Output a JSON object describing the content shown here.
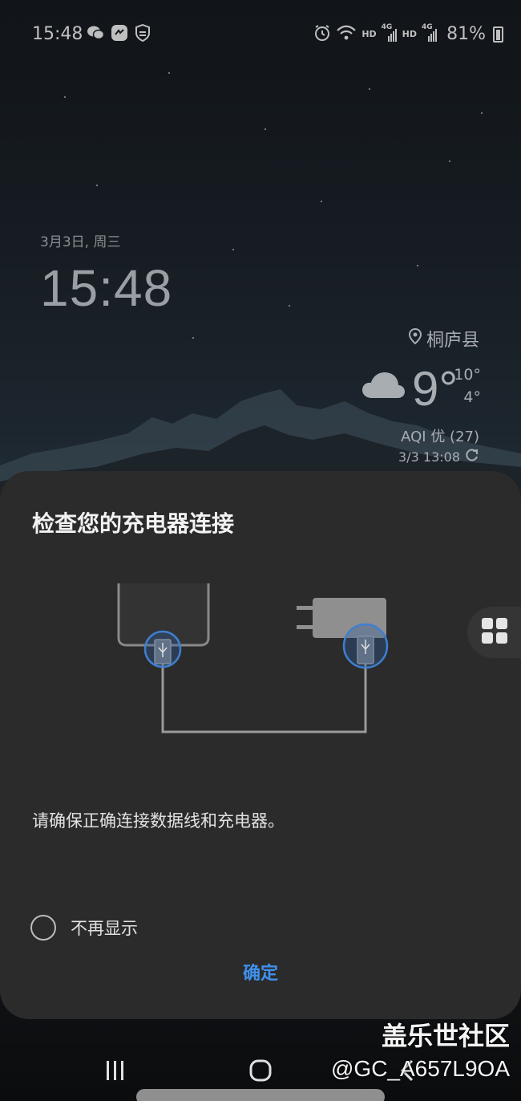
{
  "status_bar": {
    "time": "15:48",
    "left_icons": [
      "wechat-icon",
      "messenger-icon",
      "shield-icon"
    ],
    "right_icons": [
      "alarm-icon",
      "wifi-icon",
      "signal-icon-sim1",
      "signal-icon-sim2"
    ],
    "hd_label_1": "HD",
    "hd_label_2": "HD",
    "net_label_1": "4G",
    "net_label_2": "4G",
    "battery": "81%"
  },
  "lockscreen": {
    "date": "3月3日, 周三",
    "clock": "15:48"
  },
  "weather": {
    "location": "桐庐县",
    "temperature": "9°",
    "high": "10°",
    "low": "4°",
    "aqi": "AQI 优 (27)",
    "updated": "3/3 13:08",
    "icon": "cloud-icon"
  },
  "dialog": {
    "title": "检查您的充电器连接",
    "message": "请确保正确连接数据线和充电器。",
    "checkbox_label": "不再显示",
    "checkbox_checked": false,
    "confirm_label": "确定",
    "accent_color": "#3f91ec"
  },
  "navigation": {
    "recents_icon": "recents-icon",
    "home_icon": "home-icon",
    "back_icon": "back-icon"
  },
  "watermark": {
    "site": "盖乐世社区",
    "user": "@GC_A657L9OA"
  }
}
